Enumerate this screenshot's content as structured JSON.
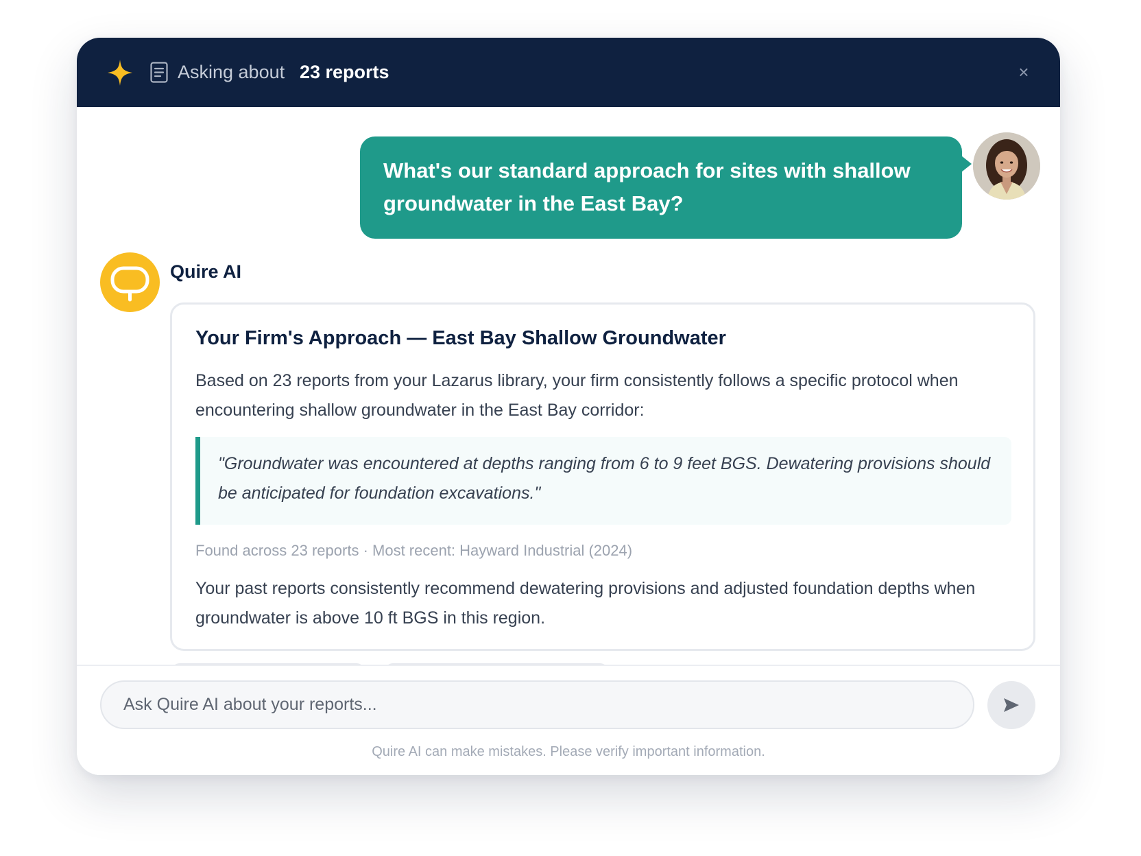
{
  "header": {
    "prefix": "Asking about",
    "count_label": "23 reports",
    "close_glyph": "×",
    "sparkle_icon": "sparkle-icon",
    "doc_icon": "document-icon",
    "accent_color": "#f9bd22",
    "background_color": "#0f2140"
  },
  "conversation": {
    "user_message": "What's our standard approach for sites with shallow groundwater in the East Bay?",
    "user_bubble_color": "#1f9a8a",
    "assistant_name": "Quire AI",
    "assistant_logo_color": "#f9bd22",
    "response": {
      "title": "Your Firm's Approach — East Bay Shallow Groundwater",
      "intro": "Based on 23 reports from your Lazarus library, your firm consistently follows a specific protocol when encountering shallow groundwater in the East Bay corridor:",
      "quote": "\"Groundwater was encountered at depths ranging from 6 to 9 feet BGS. Dewatering provisions should be anticipated for foundation excavations.\"",
      "meta": "Found across 23 reports · Most recent: Hayward Industrial (2024)",
      "summary": "Your past reports consistently recommend dewatering provisions and adjusted foundation depths when groundwater is above 10 ft BGS in this region."
    }
  },
  "composer": {
    "placeholder": "Ask Quire AI about your reports...",
    "value": "",
    "send_icon": "send-icon",
    "disclaimer": "Quire AI can make mistakes. Please verify important information."
  }
}
